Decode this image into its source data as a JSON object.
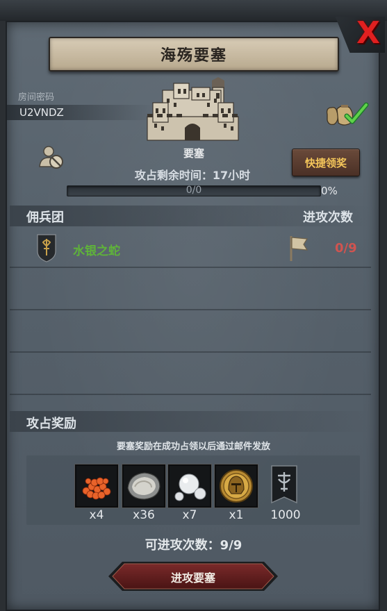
{
  "dialog": {
    "title": "海殇要塞",
    "close_symbol": "X"
  },
  "room": {
    "label": "房间密码",
    "code": "U2VNDZ"
  },
  "fortress": {
    "name": "要塞",
    "time_remaining": "攻占剩余时间：17小时",
    "progress_text": "0/0",
    "progress_fraction": 0,
    "progress_percent": "0%",
    "quick_claim_label": "快捷领奖"
  },
  "mercenary": {
    "section_title": "佣兵团",
    "attacks_header": "进攻次数",
    "rows": [
      {
        "name": "水银之蛇",
        "attacks": "0/9"
      }
    ]
  },
  "rewards": {
    "section_title": "攻占奖励",
    "note": "要塞奖励在成功占领以后通过邮件发放",
    "items": [
      {
        "icon": "caviar-icon",
        "qty": "x4"
      },
      {
        "icon": "oyster-icon",
        "qty": "x36"
      },
      {
        "icon": "pearls-icon",
        "qty": "x7"
      },
      {
        "icon": "gold-helmet-medal-icon",
        "qty": "x1"
      },
      {
        "icon": "banner-icon",
        "qty": "1000"
      }
    ]
  },
  "footer": {
    "attacks_left": "可进攻次数：9/9",
    "attack_button": "进攻要塞"
  },
  "colors": {
    "accent_gold": "#f3c55a",
    "guild_green": "#5fb33a",
    "count_red": "#d05450",
    "close_red": "#e02020"
  }
}
